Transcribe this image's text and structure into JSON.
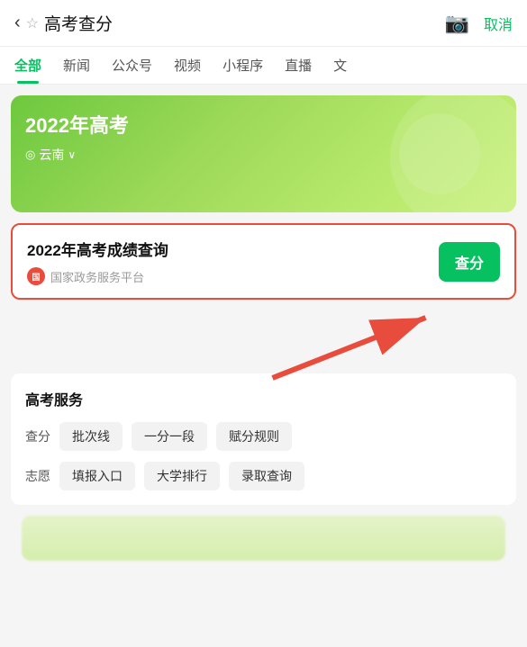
{
  "topBar": {
    "backLabel": "‹",
    "starLabel": "☆",
    "title": "高考查分",
    "cameraLabel": "📷",
    "cancelLabel": "取消"
  },
  "tabs": [
    {
      "id": "all",
      "label": "全部",
      "active": true
    },
    {
      "id": "news",
      "label": "新闻",
      "active": false
    },
    {
      "id": "gzh",
      "label": "公众号",
      "active": false
    },
    {
      "id": "video",
      "label": "视频",
      "active": false
    },
    {
      "id": "mini",
      "label": "小程序",
      "active": false
    },
    {
      "id": "live",
      "label": "直播",
      "active": false
    },
    {
      "id": "wen",
      "label": "文",
      "active": false
    }
  ],
  "banner": {
    "title": "2022年高考",
    "locationLabel": "云南",
    "locationArrow": "∨"
  },
  "resultCard": {
    "title": "2022年高考成绩查询",
    "sourceLogoText": "国",
    "sourceName": "国家政务服务平台",
    "queryButtonLabel": "查分"
  },
  "arrow": {
    "symbol": "↑"
  },
  "services": {
    "sectionTitle": "高考服务",
    "rows": [
      {
        "label": "查分",
        "tags": [
          "批次线",
          "一分一段",
          "赋分规则"
        ]
      },
      {
        "label": "志愿",
        "tags": [
          "填报入口",
          "大学排行",
          "录取查询"
        ]
      }
    ]
  }
}
